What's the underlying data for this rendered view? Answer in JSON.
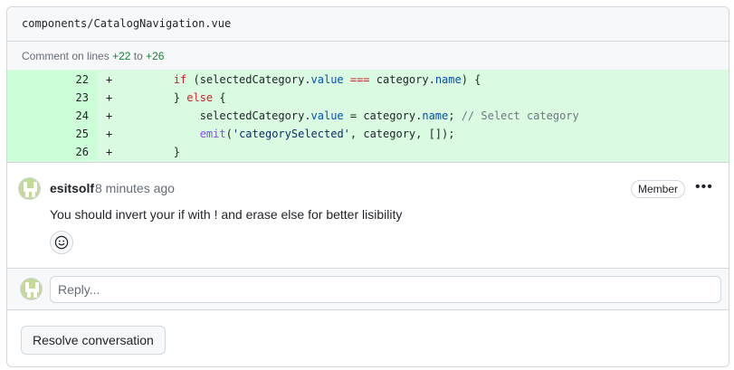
{
  "file": {
    "path": "components/CatalogNavigation.vue"
  },
  "lines_info": {
    "prefix": "Comment on lines",
    "from": "+22",
    "to_word": "to",
    "to": "+26"
  },
  "diff": {
    "rows": [
      {
        "num": "22",
        "sign": "+"
      },
      {
        "num": "23",
        "sign": "+"
      },
      {
        "num": "24",
        "sign": "+"
      },
      {
        "num": "25",
        "sign": "+"
      },
      {
        "num": "26",
        "sign": "+"
      }
    ],
    "tokens": {
      "r22_a": "        ",
      "r22_kw1": "if",
      "r22_b": " (selectedCategory.",
      "r22_p1": "value",
      "r22_c": " ",
      "r22_op": "===",
      "r22_d": " category.",
      "r22_p2": "name",
      "r22_e": ") {",
      "r23_a": "        } ",
      "r23_kw": "else",
      "r23_b": " {",
      "r24_a": "            selectedCategory.",
      "r24_p1": "value",
      "r24_b": " = category.",
      "r24_p2": "name",
      "r24_c": "; ",
      "r24_cm": "// Select category",
      "r25_a": "            ",
      "r25_fn": "emit",
      "r25_b": "(",
      "r25_str": "'categorySelected'",
      "r25_c": ", category, []);",
      "r26_a": "        }"
    }
  },
  "comment": {
    "author": "esitsolf",
    "timestamp": "8 minutes ago",
    "role_badge": "Member",
    "more_icon": "kebab-horizontal-icon",
    "body": "You should invert your if with ! and erase else for better lisibility",
    "reaction_icon": "smiley-icon"
  },
  "reply": {
    "placeholder": "Reply..."
  },
  "actions": {
    "resolve_label": "Resolve conversation"
  },
  "colors": {
    "added_bg": "#dafbe1",
    "added_num_bg": "#ccffd8",
    "avatar_bg": "#c5d99b",
    "border": "#d0d7de"
  }
}
